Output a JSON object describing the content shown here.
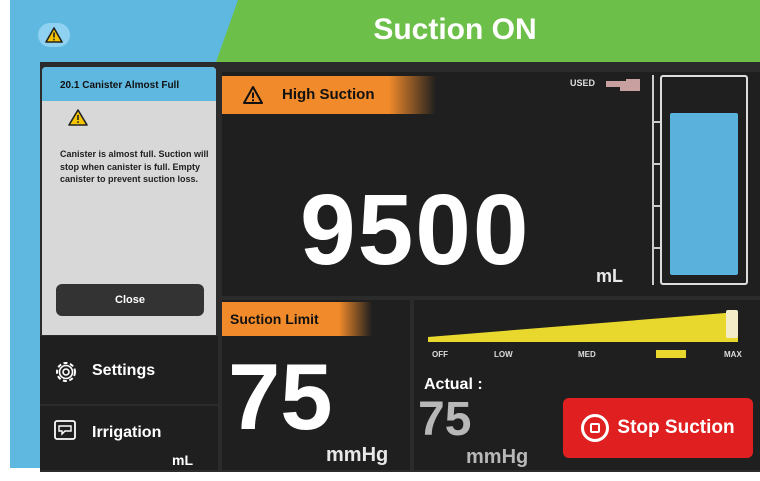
{
  "header": {
    "status": "Suction ON",
    "alert_icon": "warning-triangle-icon"
  },
  "colors": {
    "accent_blue": "#5fb8e0",
    "status_green": "#6cc04a",
    "alert_orange": "#f08a2a",
    "stop_red": "#e02020",
    "level_yellow": "#e8d82e"
  },
  "alert_dialog": {
    "title": "20.1 Canister Almost Full",
    "message": "Canister is almost full. Suction will stop when canister is full. Empty canister to prevent suction loss.",
    "close_label": "Close",
    "icon": "warning-triangle-icon"
  },
  "sidebar": {
    "settings_label": "Settings",
    "irrigation_label": "Irrigation",
    "irrigation_unit": "mL"
  },
  "volume": {
    "alarm_label": "High Suction",
    "value": "9500",
    "unit": "mL",
    "used_label": "USED",
    "canister_fill_fraction": 0.85
  },
  "suction_limit": {
    "label": "Suction Limit",
    "value": "75",
    "unit": "mmHg"
  },
  "suction_level": {
    "levels": [
      "OFF",
      "LOW",
      "MED",
      "MAX"
    ],
    "setting_fraction": 0.98
  },
  "actual": {
    "label": "Actual :",
    "value": "75",
    "unit": "mmHg"
  },
  "stop_button": {
    "label": "Stop Suction"
  }
}
